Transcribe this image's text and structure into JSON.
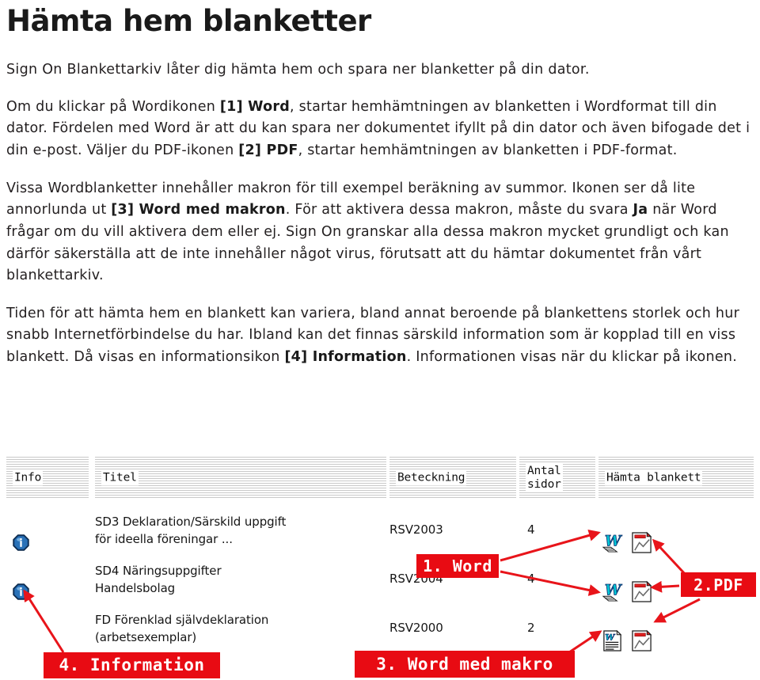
{
  "article": {
    "title": "Hämta hem blanketter",
    "lede": "Sign On Blankettarkiv låter dig hämta hem och spara ner blanketter på din dator.",
    "paragraphs": [
      {
        "runs": [
          {
            "text": "Om du klickar på Wordikonen ",
            "bold": false
          },
          {
            "text": "[1] Word",
            "bold": true
          },
          {
            "text": ", startar hemhämtningen av blanketten i Wordformat till din dator. Fördelen med Word är att du kan spara ner dokumentet ifyllt på din dator och även bifogade det i din e-post. Väljer du PDF-ikonen ",
            "bold": false
          },
          {
            "text": "[2] PDF",
            "bold": true
          },
          {
            "text": ", startar hemhämtningen av blanketten i PDF-format.",
            "bold": false
          }
        ]
      },
      {
        "runs": [
          {
            "text": "Vissa Wordblanketter innehåller makron för till exempel beräkning av summor. Ikonen ser då lite annorlunda ut ",
            "bold": false
          },
          {
            "text": "[3] Word med makron",
            "bold": true
          },
          {
            "text": ". För att aktivera dessa makron, måste du svara ",
            "bold": false
          },
          {
            "text": "Ja",
            "bold": true
          },
          {
            "text": " när Word frågar om du vill aktivera dem eller ej. Sign On granskar alla dessa makron mycket grundligt och kan därför säkerställa att de inte innehåller något virus, förutsatt att du hämtar dokumentet från vårt blankettarkiv.",
            "bold": false
          }
        ]
      },
      {
        "runs": [
          {
            "text": "Tiden för att hämta hem en blankett kan variera, bland annat beroende på blankettens storlek och hur snabb Internetförbindelse du har. Ibland kan det finnas särskild information som är kopplad till en viss blankett. Då visas en informationsikon ",
            "bold": false
          },
          {
            "text": "[4] Information",
            "bold": true
          },
          {
            "text": ". Informationen visas när du klickar på ikonen.",
            "bold": false
          }
        ]
      }
    ]
  },
  "screenshot": {
    "table": {
      "headers": [
        {
          "key": "info",
          "label": "Info"
        },
        {
          "key": "titel",
          "label": "Titel"
        },
        {
          "key": "beteck",
          "label": "Beteckning"
        },
        {
          "key": "antal",
          "label": "Antal\nsidor"
        },
        {
          "key": "hamta",
          "label": "Hämta blankett"
        }
      ],
      "rows": [
        {
          "has_info_icon": true,
          "titel": "SD3 Deklaration/Särskild uppgift\nför ideella föreningar ...",
          "beteckning": "RSV2003",
          "antal_sidor": "4",
          "download_icons": [
            "word-icon",
            "pdf-icon"
          ]
        },
        {
          "has_info_icon": true,
          "titel": "SD4 Näringsuppgifter\nHandelsbolag",
          "beteckning": "RSV2004",
          "antal_sidor": "4",
          "download_icons": [
            "word-icon",
            "pdf-icon"
          ]
        },
        {
          "has_info_icon": false,
          "titel": "FD Förenklad självdeklaration\n(arbetsexemplar)",
          "beteckning": "RSV2000",
          "antal_sidor": "2",
          "download_icons": [
            "word-macro-icon",
            "pdf-icon"
          ]
        }
      ]
    },
    "callouts": [
      {
        "key": "word",
        "label": "1. Word"
      },
      {
        "key": "pdf",
        "label": "2.PDF"
      },
      {
        "key": "makro",
        "label": "3. Word med makro"
      },
      {
        "key": "info",
        "label": "4. Information"
      }
    ]
  },
  "colors": {
    "callout_red": "#e80b13",
    "arrow_red": "#e8141a",
    "text": "#231f20",
    "info_icon_blue": "#1a5d9e"
  }
}
